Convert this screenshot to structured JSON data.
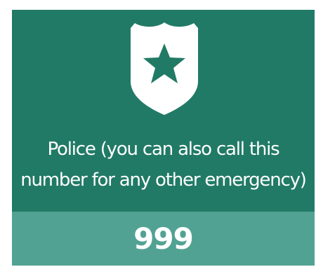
{
  "colors": {
    "card_top": "#217a66",
    "card_bottom": "#52a293",
    "text": "#ffffff"
  },
  "card": {
    "icon": "police-badge-shield-star-icon",
    "label": "Police (you can also call this\nnumber for any other emergency)",
    "number": "999"
  }
}
